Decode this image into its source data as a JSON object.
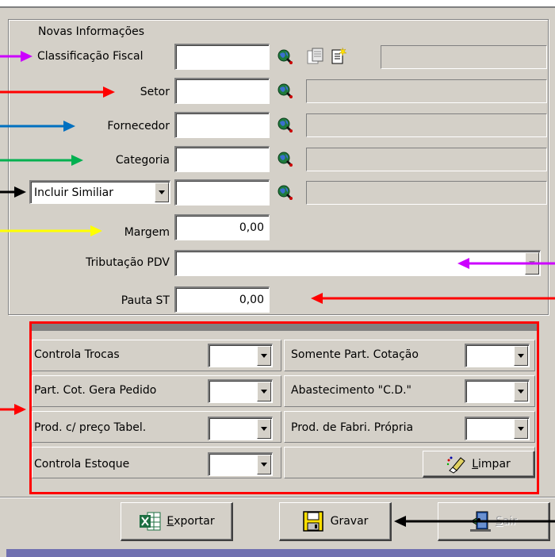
{
  "group": {
    "title": "Novas Informações"
  },
  "fields": {
    "classificacao_fiscal": {
      "label": "Classificação Fiscal",
      "value": ""
    },
    "setor": {
      "label": "Setor",
      "value": ""
    },
    "fornecedor": {
      "label": "Fornecedor",
      "value": ""
    },
    "categoria": {
      "label": "Categoria",
      "value": ""
    },
    "similar": {
      "selected": "Incluir Similiar",
      "value": ""
    },
    "margem": {
      "label": "Margem",
      "value": "0,00"
    },
    "tributacao_pdv": {
      "label": "Tributação PDV",
      "value": ""
    },
    "pauta_st": {
      "label": "Pauta ST",
      "value": "0,00"
    }
  },
  "options": {
    "left": [
      {
        "label": "Controla Trocas",
        "value": ""
      },
      {
        "label": "Part. Cot. Gera Pedido",
        "value": ""
      },
      {
        "label": "Prod. c/ preço Tabel.",
        "value": ""
      },
      {
        "label": "Controla Estoque",
        "value": ""
      }
    ],
    "right": [
      {
        "label": "Somente Part. Cotação",
        "value": ""
      },
      {
        "label": "Abastecimento \"C.D.\"",
        "value": ""
      },
      {
        "label": "Prod. de Fabri. Própria",
        "value": ""
      }
    ],
    "clear_button": {
      "pre": "",
      "accel": "L",
      "post": "impar"
    }
  },
  "buttons": {
    "export": {
      "pre": "",
      "accel": "E",
      "post": "xportar"
    },
    "save": {
      "label": "Gravar"
    },
    "exit": {
      "pre": "",
      "accel": "S",
      "post": "air"
    }
  },
  "colors": {
    "window_bg": "#d4d0c8",
    "arrow_magenta": "#cc00ff",
    "arrow_red": "#ff0000",
    "arrow_blue": "#0070c0",
    "arrow_green": "#00b050",
    "arrow_black": "#000000",
    "arrow_yellow": "#ffff00",
    "panel_border": "#ff0000"
  },
  "icons": [
    "search-globe-icon",
    "document-copy-icon",
    "new-document-icon",
    "excel-icon",
    "floppy-disk-icon",
    "exit-door-icon",
    "eraser-icon",
    "dropdown-arrow-icon"
  ]
}
